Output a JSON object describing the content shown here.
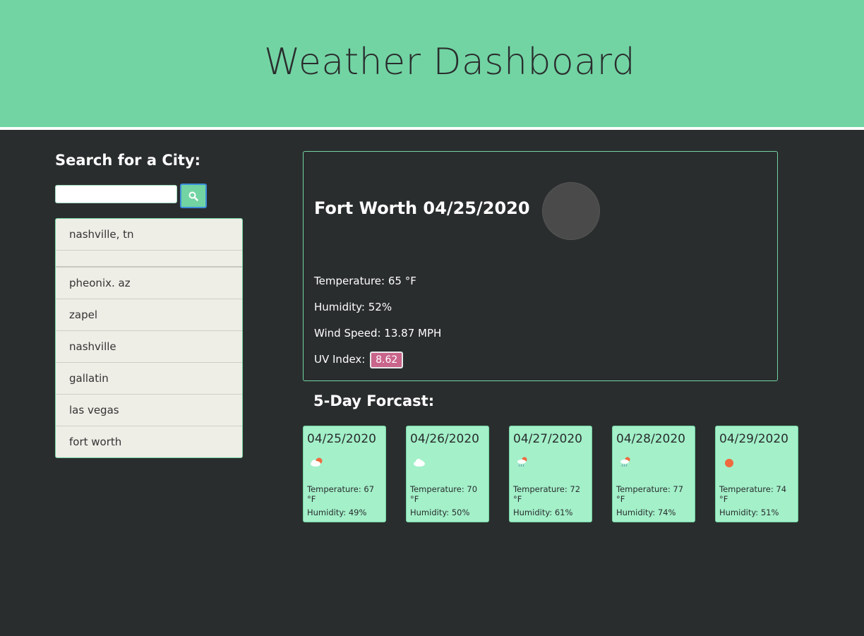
{
  "header": {
    "title": "Weather Dashboard"
  },
  "search": {
    "heading": "Search for a City:",
    "input_value": "",
    "button_icon": "search-icon"
  },
  "history": [
    "nashville, tn",
    "",
    "pheonix. az",
    "zapel",
    "nashville",
    "gallatin",
    "las vegas",
    "fort worth"
  ],
  "current": {
    "title": "Fort Worth 04/25/2020",
    "icon": "weather-icon",
    "temperature": "Temperature: 65 °F",
    "humidity": "Humidity: 52%",
    "wind": "Wind Speed: 13.87 MPH",
    "uv_label": "UV Index:",
    "uv_value": "8.62"
  },
  "forecast": {
    "heading": "5-Day Forcast:",
    "days": [
      {
        "date": "04/25/2020",
        "icon": "partly-cloudy-sun-icon",
        "temp": "Temperature: 67 °F",
        "humidity": "Humidity: 49%"
      },
      {
        "date": "04/26/2020",
        "icon": "cloud-icon",
        "temp": "Temperature: 70 °F",
        "humidity": "Humidity: 50%"
      },
      {
        "date": "04/27/2020",
        "icon": "rain-sun-icon",
        "temp": "Temperature: 72 °F",
        "humidity": "Humidity: 61%"
      },
      {
        "date": "04/28/2020",
        "icon": "rain-sun-icon",
        "temp": "Temperature: 77 °F",
        "humidity": "Humidity: 74%"
      },
      {
        "date": "04/29/2020",
        "icon": "sun-icon",
        "temp": "Temperature: 74 °F",
        "humidity": "Humidity: 51%"
      }
    ]
  },
  "colors": {
    "header_bg": "#72d4a3",
    "page_bg": "#2a2d2e",
    "card_bg": "#a3f0c9",
    "uv_badge": "#c9648a"
  }
}
